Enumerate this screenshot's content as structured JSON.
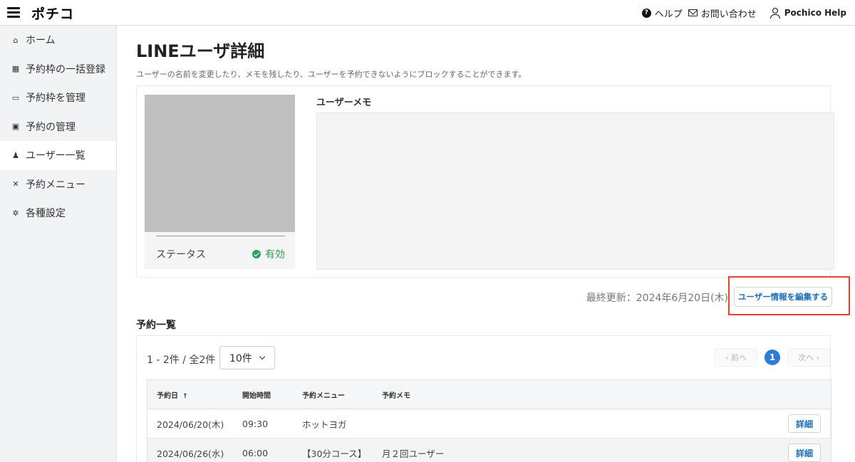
{
  "header": {
    "logo": "ポチコ",
    "help_label": "ヘルプ",
    "contact_label": "お問い合わせ",
    "user_name": "Pochico Help"
  },
  "sidebar": {
    "items": [
      {
        "label": "ホーム",
        "icon": "home-icon"
      },
      {
        "label": "予約枠の一括登録",
        "icon": "calendar-icon"
      },
      {
        "label": "予約枠を管理",
        "icon": "calendar-icon"
      },
      {
        "label": "予約の管理",
        "icon": "calendar-check-icon"
      },
      {
        "label": "ユーザー一覧",
        "icon": "user-icon"
      },
      {
        "label": "予約メニュー",
        "icon": "utensils-icon"
      },
      {
        "label": "各種設定",
        "icon": "gear-icon"
      }
    ],
    "active_index": 4
  },
  "page": {
    "title": "LINEユーザ詳細",
    "description": "ユーザーの名前を変更したり、メモを残したり、ユーザーを予約できないようにブロックすることができます。"
  },
  "profile": {
    "status_label": "ステータス",
    "status_value": "有効",
    "memo_label": "ユーザーメモ",
    "memo_value": ""
  },
  "actions": {
    "last_updated": "最終更新：2024年6月20日(木)",
    "edit_label": "ユーザー情報を編集する"
  },
  "bookings": {
    "section_title": "予約一覧",
    "count_text": "1 - 2件 / 全2件",
    "per_page": "10件",
    "pager": {
      "prev": "‹ 前へ",
      "current": "1",
      "next": "次へ ›"
    },
    "columns": [
      "予約日",
      "開始時間",
      "予約メニュー",
      "予約メモ"
    ],
    "sort_indicator": "↑",
    "detail_label": "詳細",
    "rows": [
      {
        "date": "2024/06/20(木)",
        "time": "09:30",
        "menu": "ホットヨガ",
        "memo": ""
      },
      {
        "date": "2024/06/26(水)",
        "time": "06:00",
        "menu": "【30分コース】",
        "memo": "月２回ユーザー"
      }
    ]
  },
  "colors": {
    "accent": "#1f6fb9",
    "status_active": "#2e9e5b",
    "highlight": "#e0462f",
    "pager_active": "#2f7ad6"
  }
}
